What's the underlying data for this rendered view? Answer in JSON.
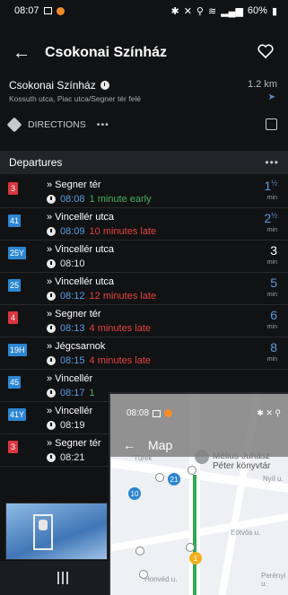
{
  "status_bar": {
    "time": "08:07",
    "battery": "60%"
  },
  "appbar": {
    "title": "Csokonai Színház"
  },
  "stop": {
    "name": "Csokonai Színház",
    "distance": "1.2 km",
    "streets": "Kossuth utca, Piac utca/Segner tér felé"
  },
  "actions": {
    "directions_label": "DIRECTIONS",
    "more": "•••"
  },
  "departures": {
    "header": "Departures",
    "more": "•••"
  },
  "rows": [
    {
      "route": "3",
      "color": "red",
      "dest": "» Segner tér",
      "time": "08:08",
      "time_kind": "live",
      "status": "1 minute early",
      "status_kind": "early",
      "eta": "1",
      "eta_frac": "½",
      "eta_kind": "live",
      "min": "min"
    },
    {
      "route": "41",
      "color": "blue",
      "dest": "» Vincellér utca",
      "time": "08:09",
      "time_kind": "live",
      "status": "10 minutes late",
      "status_kind": "late",
      "eta": "2",
      "eta_frac": "½",
      "eta_kind": "live",
      "min": "min"
    },
    {
      "route": "25Y",
      "color": "blue",
      "dest": "» Vincellér utca",
      "time": "08:10",
      "time_kind": "sched",
      "status": "",
      "status_kind": "",
      "eta": "3",
      "eta_frac": "",
      "eta_kind": "plain",
      "min": "min"
    },
    {
      "route": "25",
      "color": "blue",
      "dest": "» Vincellér utca",
      "time": "08:12",
      "time_kind": "live",
      "status": "12 minutes late",
      "status_kind": "late",
      "eta": "5",
      "eta_frac": "",
      "eta_kind": "live",
      "min": "min"
    },
    {
      "route": "4",
      "color": "red",
      "dest": "» Segner tér",
      "time": "08:13",
      "time_kind": "live",
      "status": "4 minutes late",
      "status_kind": "late",
      "eta": "6",
      "eta_frac": "",
      "eta_kind": "live",
      "min": "min"
    },
    {
      "route": "19H",
      "color": "blue",
      "dest": "» Jégcsarnok",
      "time": "08:15",
      "time_kind": "live",
      "status": "4 minutes late",
      "status_kind": "late",
      "eta": "8",
      "eta_frac": "",
      "eta_kind": "live",
      "min": "min"
    },
    {
      "route": "45",
      "color": "blue",
      "dest": "» Vincellér",
      "time": "08:17",
      "time_kind": "live",
      "status": "1",
      "status_kind": "early",
      "eta": "",
      "eta_frac": "",
      "eta_kind": "plain",
      "min": ""
    },
    {
      "route": "41Y",
      "color": "blue",
      "dest": "» Vincellér",
      "time": "08:19",
      "time_kind": "sched",
      "status": "",
      "status_kind": "",
      "eta": "",
      "eta_frac": "",
      "eta_kind": "plain",
      "min": ""
    },
    {
      "route": "3",
      "color": "red",
      "dest": "» Segner tér",
      "time": "08:21",
      "time_kind": "sched",
      "status": "",
      "status_kind": "",
      "eta": "",
      "eta_frac": "",
      "eta_kind": "plain",
      "min": ""
    }
  ],
  "pip": {
    "time": "08:08",
    "title": "Map",
    "poi_label": "Mélius-Juhász Péter könyvtár",
    "streets": [
      "Türek",
      "Nyíl u.",
      "Eötvös u.",
      "Honvéd u.",
      "Perényi u."
    ],
    "badges": [
      {
        "label": "21",
        "color": "#2c86d1"
      },
      {
        "label": "10",
        "color": "#2c86d1"
      },
      {
        "label": "1",
        "color": "#f2b01e"
      }
    ]
  }
}
